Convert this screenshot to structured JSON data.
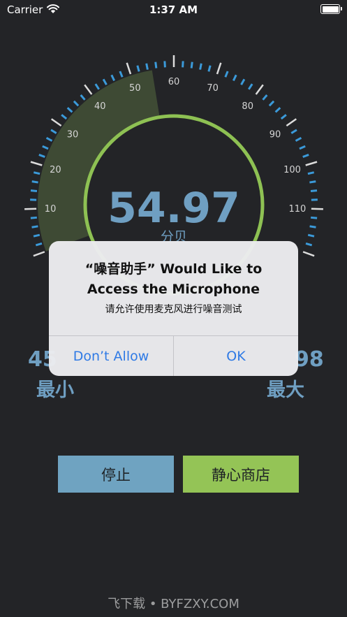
{
  "status_bar": {
    "carrier": "Carrier",
    "time": "1:37 AM"
  },
  "gauge": {
    "value_text": "54.97",
    "unit": "分贝",
    "value": 54.97,
    "min": 0,
    "max": 120,
    "scale_labels": [
      "10",
      "20",
      "30",
      "40",
      "50",
      "60",
      "70",
      "80",
      "90",
      "100",
      "110"
    ],
    "colors": {
      "fill": "#3e4a34",
      "ring": "#8ec153",
      "value_text": "#6f9fc2",
      "tick_blue": "#3b9ad9",
      "tick_white": "#dcdcdc"
    }
  },
  "stats": {
    "min_value": "45",
    "min_label": "最小",
    "max_value": "98",
    "max_label": "最大"
  },
  "buttons": {
    "stop": "停止",
    "shop": "静心商店"
  },
  "watermark": "飞下载 • BYFZXY.COM",
  "dialog": {
    "title_line1": "“噪音助手” Would Like to",
    "title_line2": "Access the Microphone",
    "message": "请允许使用麦克风进行噪音测试",
    "dont_allow": "Don’t Allow",
    "ok": "OK"
  }
}
